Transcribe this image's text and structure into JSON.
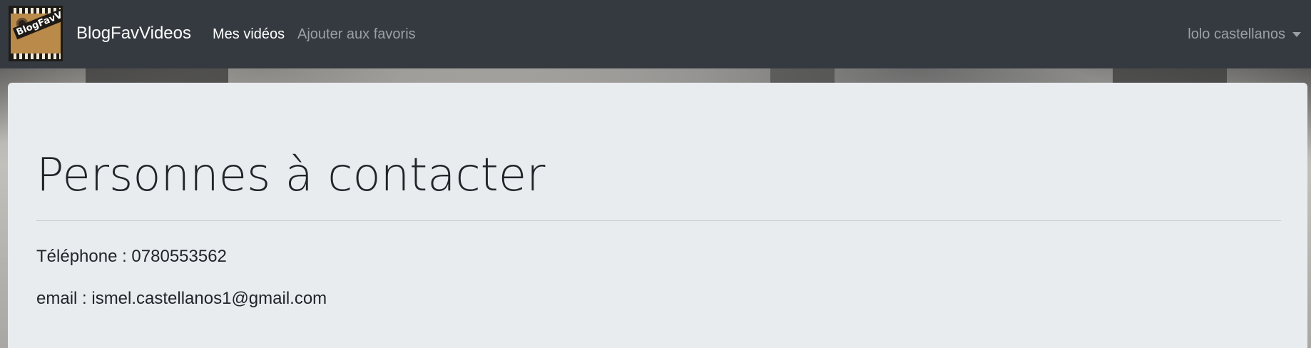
{
  "navbar": {
    "logo_text": "BlogFavVideo",
    "brand": "BlogFavVideos",
    "links": [
      {
        "label": "Mes vidéos",
        "active": true
      },
      {
        "label": "Ajouter aux favoris",
        "active": false
      }
    ],
    "user_name": "lolo castellanos"
  },
  "contact": {
    "title": "Personnes à contacter",
    "phone": "Téléphone : 0780553562",
    "email": "email : ismel.castellanos1@gmail.com"
  },
  "colors": {
    "navbar_bg": "#343a40",
    "jumbotron_bg": "#e9ecef",
    "text": "#212529",
    "muted_link": "#9aa0a6"
  }
}
